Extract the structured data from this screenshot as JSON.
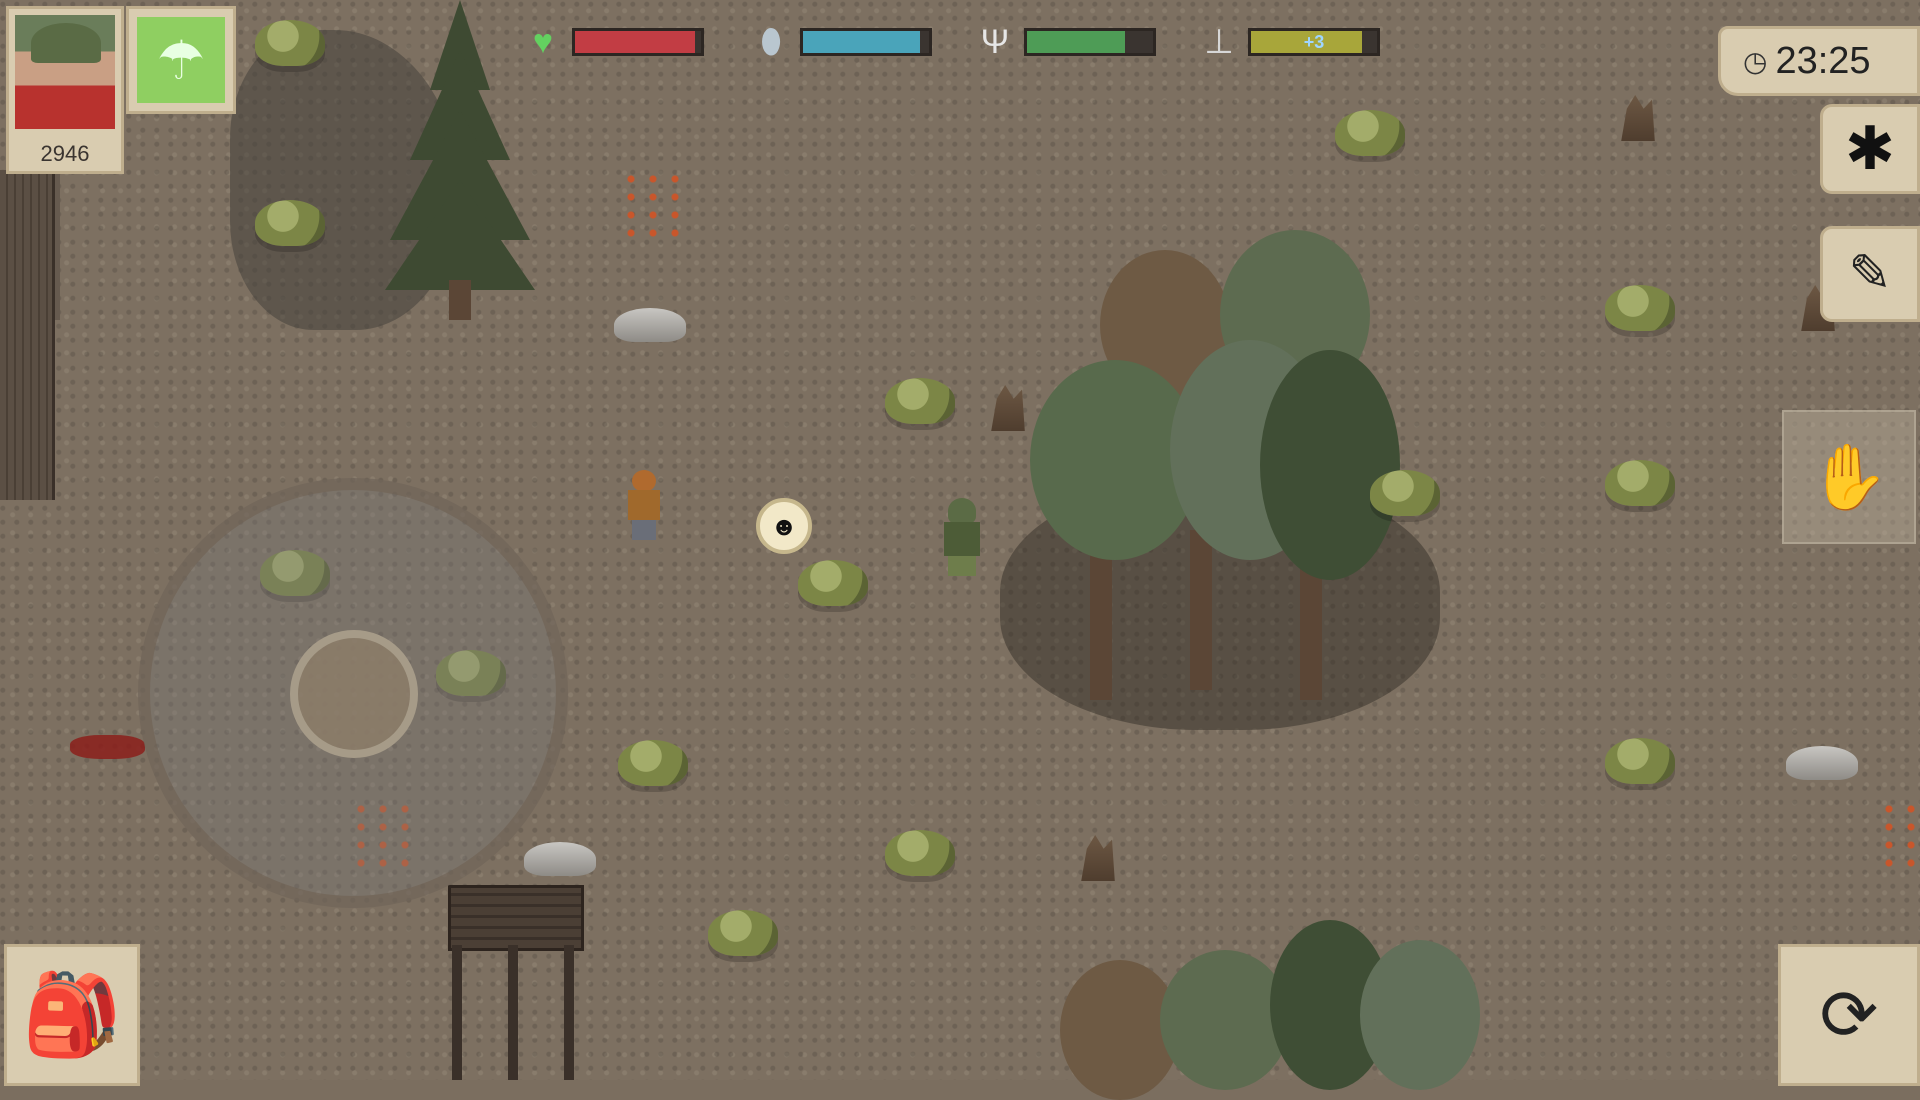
{
  "hud": {
    "score": "2946",
    "airdrop_icon": "parachute-icon",
    "stats": [
      {
        "name": "health",
        "icon": "heart-icon",
        "glyph": "♥",
        "icon_color": "#63d160",
        "fill_fraction": 0.95,
        "bar_color": "#c23d44",
        "text": ""
      },
      {
        "name": "water",
        "icon": "water-drop-icon",
        "glyph": "💧",
        "icon_color": "#b9c6cf",
        "fill_fraction": 0.93,
        "bar_color": "#4aa4ba",
        "text": ""
      },
      {
        "name": "food",
        "icon": "fork-knife-icon",
        "glyph": "🍴",
        "icon_color": "#e6e6e6",
        "fill_fraction": 0.78,
        "bar_color": "#4e9c56",
        "text": ""
      },
      {
        "name": "temperature",
        "icon": "thermometer-icon",
        "glyph": "🌡",
        "icon_color": "#d7d7d7",
        "fill_fraction": 0.88,
        "bar_color": "#a8a63a",
        "text": "+3"
      }
    ],
    "clock_icon": "clock-icon",
    "time": "23:25",
    "settings_icon": "gear-icon",
    "notes_icon": "notes-question-icon",
    "interact_icon": "hand-icon",
    "inventory_icon": "backpack-icon",
    "weapon_icon": "weapon-swap-icon",
    "npc_marker_icon": "npc-face-icon"
  }
}
